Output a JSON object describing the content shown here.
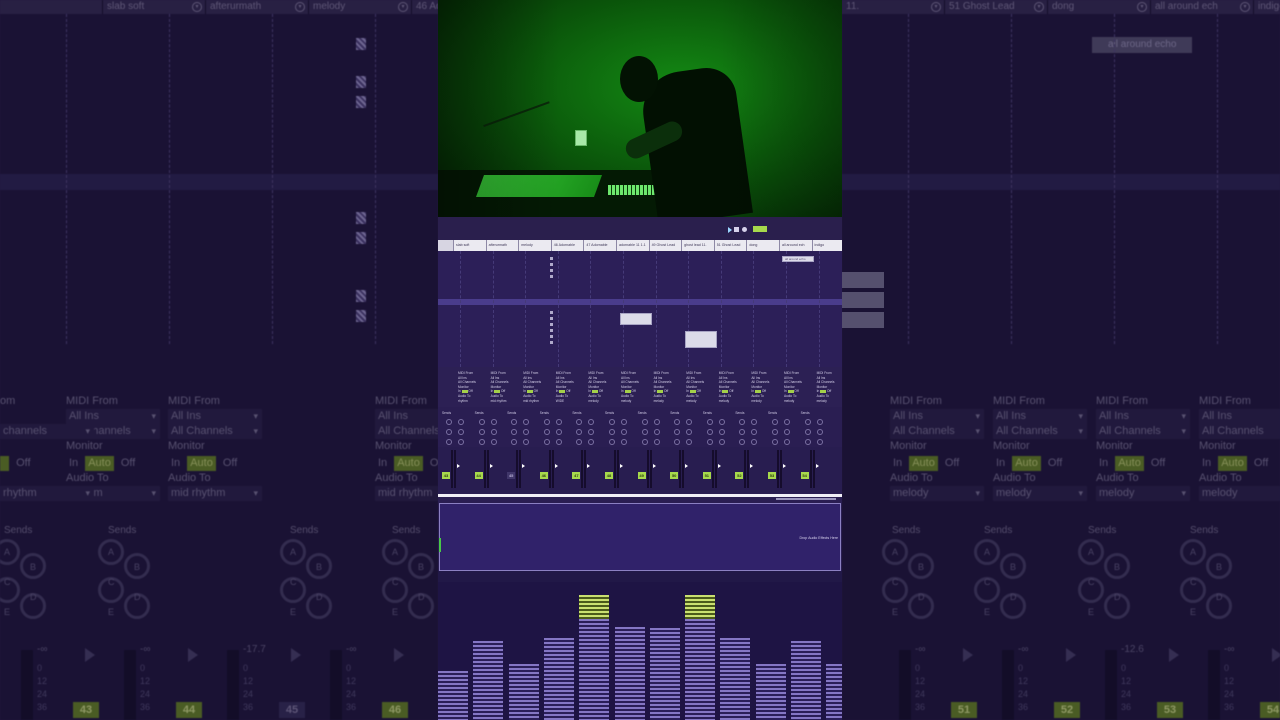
{
  "background": {
    "header_tracks": [
      "",
      "slab soft",
      "afterurmath",
      "melody",
      "46 Adornable",
      "11.",
      "51 Ghost Lead",
      "dong",
      "all around ech",
      "indigo"
    ],
    "clip_label": "all around echo",
    "io_labels": {
      "midi_from": "MIDI From",
      "all_ins": "All Ins",
      "all_channels": "All Channels",
      "monitor": "Monitor",
      "in": "In",
      "auto": "Auto",
      "off": "Off",
      "audio_to": "Audio To",
      "routes": [
        "rhythm",
        "mid rhythm",
        "mid rhythm",
        "WIDE",
        "melody",
        "melody",
        "melody",
        "melody",
        "melody"
      ],
      "from_prefix": "om",
      "channels_prefix": "channels"
    },
    "sends_label": "Sends",
    "send_letters": [
      "A",
      "B",
      "C",
      "D",
      "E"
    ],
    "fader_db": [
      "-∞",
      "-∞",
      "-17.7",
      "-∞",
      "-∞",
      "-∞",
      "-12.6",
      "-∞"
    ],
    "fader_scale": [
      "0",
      "12",
      "24",
      "36"
    ],
    "track_numbers": [
      "43",
      "44",
      "45",
      "46",
      "51",
      "52",
      "53",
      "54"
    ]
  },
  "ui": {
    "track_headers": [
      "",
      "slab soft",
      "afterurmath",
      "melody",
      "46 Adornable",
      "47 Adornable",
      "adornable 11 1.1",
      "49 Ghost Lead",
      "ghost lead 11.",
      "51 Ghost Lead",
      "dong",
      "all around ech",
      "indigo"
    ],
    "grid_clip": "all around echo",
    "io": {
      "midi_from": "MIDI From",
      "all_ins": "All Ins",
      "all_channels": "All Channels",
      "monitor": "Monitor",
      "in": "In",
      "auto": "Auto",
      "off": "Off",
      "audio_to": "Audio To",
      "routes": [
        "rhythm",
        "mid rhythm",
        "mid rhythm",
        "WIDE",
        "melody",
        "melody",
        "melody",
        "melody",
        "melody",
        "melody",
        "melody",
        "melody"
      ]
    },
    "sends_label": "Sends",
    "fader_numbers": [
      "43",
      "44",
      "45",
      "46",
      "47",
      "48",
      "49",
      "50",
      "51",
      "52",
      "53",
      "54"
    ],
    "device_drop_text": "Drop Audio Effects Here"
  },
  "equalizer": {
    "levels": [
      0.38,
      0.62,
      0.44,
      0.64,
      0.98,
      0.73,
      0.72,
      0.98,
      0.64,
      0.44,
      0.62,
      0.44
    ],
    "peak_bars": [
      4,
      7
    ],
    "colors": {
      "bar": "#8476c4",
      "peak": "#c9e070"
    }
  },
  "colors": {
    "accent_green": "#a7d94c",
    "purple_bg": "#2c1f58",
    "video_green": "#148a14"
  }
}
